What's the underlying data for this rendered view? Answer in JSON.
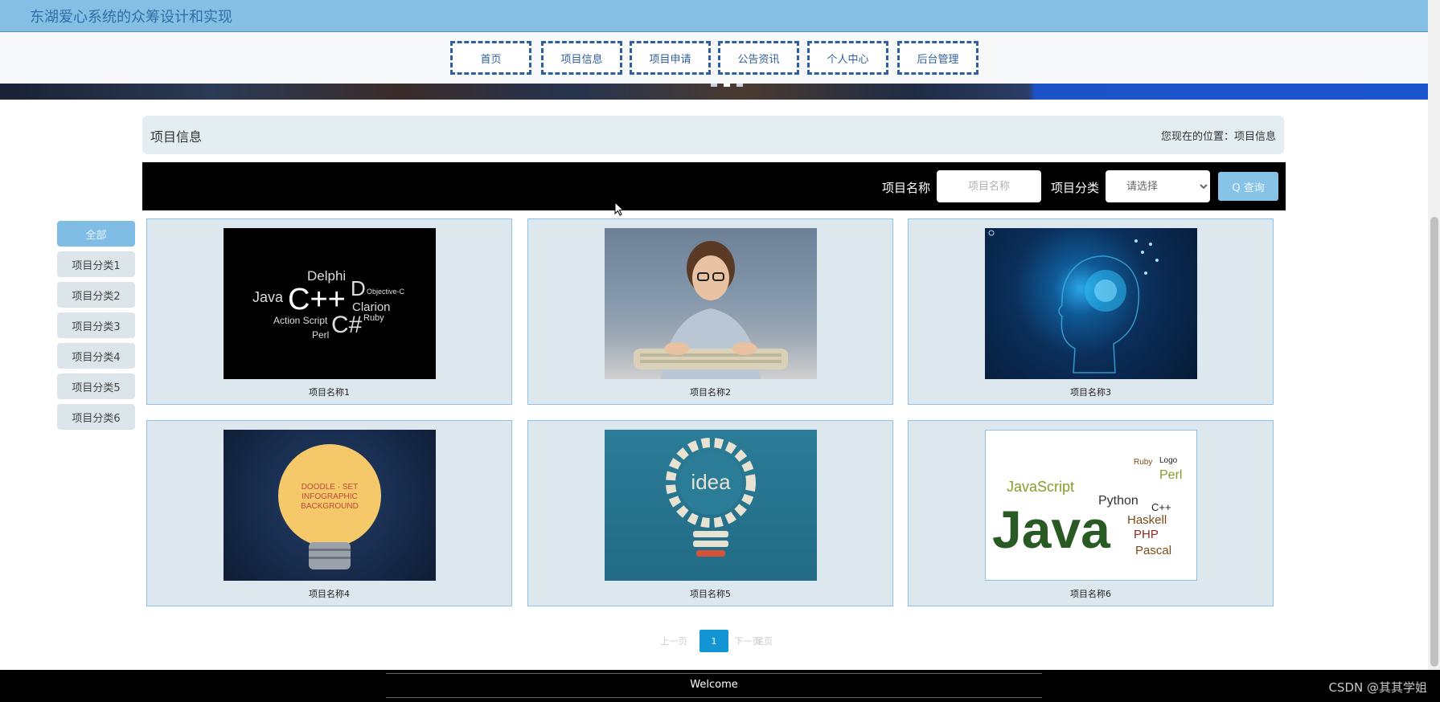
{
  "header": {
    "site_title": "东湖爱心系统的众筹设计和实现"
  },
  "nav": {
    "items": [
      {
        "label": "首页"
      },
      {
        "label": "项目信息"
      },
      {
        "label": "项目申请"
      },
      {
        "label": "公告资讯"
      },
      {
        "label": "个人中心"
      },
      {
        "label": "后台管理"
      }
    ]
  },
  "breadcrumb": {
    "page_title": "项目信息",
    "location_text": "您现在的位置：项目信息"
  },
  "search": {
    "name_label": "项目名称",
    "name_placeholder": "项目名称",
    "category_label": "项目分类",
    "category_selected": "请选择",
    "button_label": "Q 查询"
  },
  "categories": [
    {
      "label": "全部",
      "active": true
    },
    {
      "label": "项目分类1"
    },
    {
      "label": "项目分类2"
    },
    {
      "label": "项目分类3"
    },
    {
      "label": "项目分类4"
    },
    {
      "label": "项目分类5"
    },
    {
      "label": "项目分类6"
    }
  ],
  "projects": [
    {
      "name": "项目名称1",
      "image": "programming-languages-word-cloud"
    },
    {
      "name": "项目名称2",
      "image": "boy-at-keyboard"
    },
    {
      "name": "项目名称3",
      "image": "digital-brain-head"
    },
    {
      "name": "项目名称4",
      "image": "lightbulb-doodle"
    },
    {
      "name": "项目名称5",
      "image": "idea-gear-bulb"
    },
    {
      "name": "项目名称6",
      "image": "java-word-cloud"
    }
  ],
  "thumb_text": {
    "t1": {
      "w1": "Delphi",
      "w2": "C++",
      "w3": "D",
      "w4": "Java",
      "w5": "C#",
      "w6": "Clarion",
      "w7": "Action Script",
      "w8": "Perl",
      "w9": "Ruby",
      "w10": "Objective-C"
    },
    "t4": {
      "w1": "DOODLE · SET",
      "w2": "INFOGRAPHIC",
      "w3": "BACKGROUND"
    },
    "t5": {
      "w1": "idea"
    },
    "t6": {
      "w1": "Java",
      "w2": "JavaScript",
      "w3": "Python",
      "w4": "Haskell",
      "w5": "PHP",
      "w6": "Pascal",
      "w7": "C++",
      "w8": "Perl",
      "w9": "Logo",
      "w10": "Ruby"
    }
  },
  "pagination": {
    "prev": "上一页",
    "current": "1",
    "next": "下一页",
    "last": "尾页"
  },
  "footer": {
    "welcome": "Welcome",
    "watermark": "CSDN @其其学姐"
  }
}
